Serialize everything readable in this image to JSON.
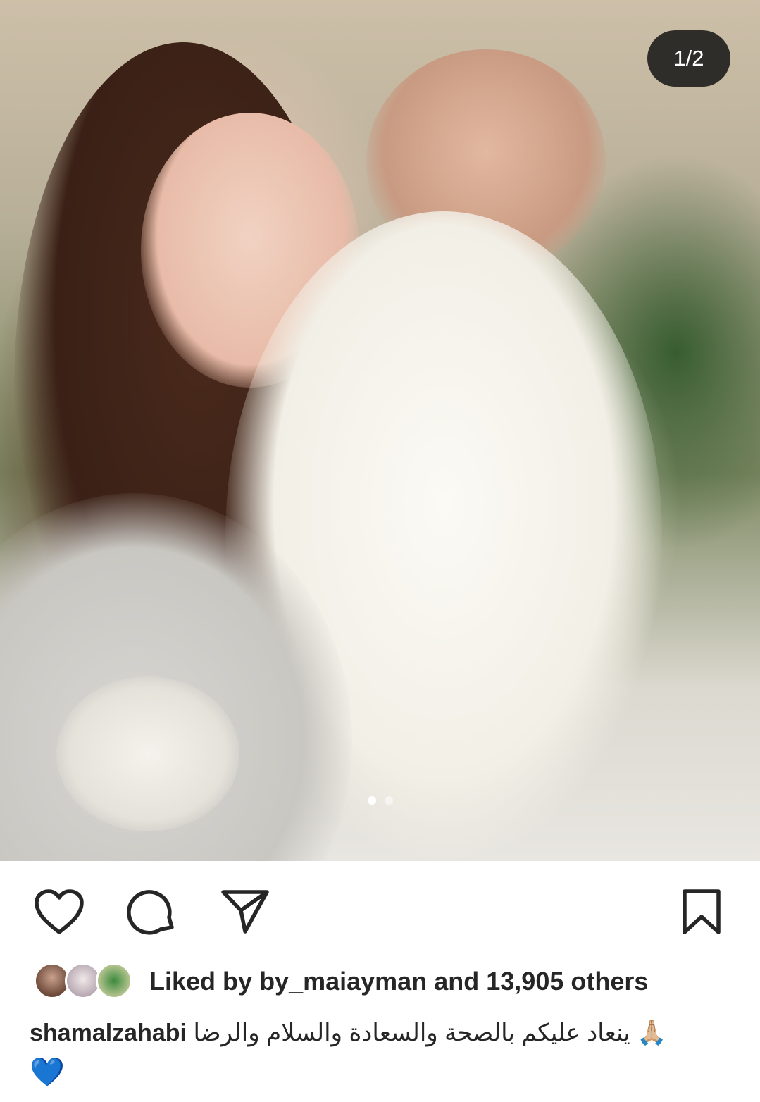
{
  "post": {
    "counter": "1/2",
    "carousel": {
      "count": 2,
      "active_index": 0
    }
  },
  "actions": {
    "like_icon": "heart-outline",
    "comment_icon": "speech-bubble",
    "share_icon": "paper-plane",
    "save_icon": "bookmark-outline"
  },
  "likes": {
    "prefix": "Liked by",
    "user": "by_maiayman",
    "middle": "and",
    "count": "13,905 others"
  },
  "caption": {
    "username": "shamalzahabi",
    "text": "ينعاد عليكم بالصحة والسعادة والسلام والرضا",
    "emoji_pray": "🙏🏼",
    "emoji_heart": "💙"
  }
}
